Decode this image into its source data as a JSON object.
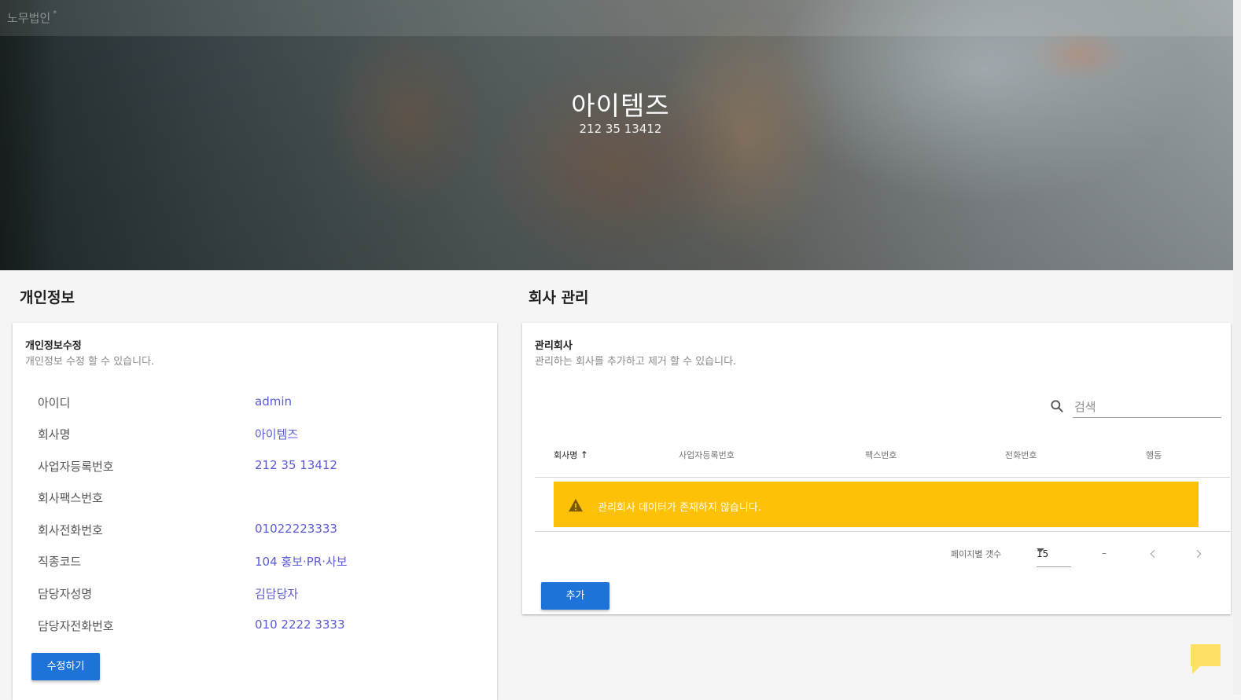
{
  "app": {
    "brand": "노무법인",
    "brand_mark": "*"
  },
  "hero": {
    "title": "아이템즈",
    "subtitle": "212 35 13412"
  },
  "personal": {
    "section_title": "개인정보",
    "card_title": "개인정보수정",
    "card_desc": "개인정보 수정 할 수 있습니다.",
    "rows": [
      {
        "label": "아이디",
        "value": "admin"
      },
      {
        "label": "회사명",
        "value": "아이템즈"
      },
      {
        "label": "사업자등록번호",
        "value": "212 35 13412"
      },
      {
        "label": "회사팩스번호",
        "value": ""
      },
      {
        "label": "회사전화번호",
        "value": "01022223333"
      },
      {
        "label": "직종코드",
        "value": "104 홍보·PR·사보"
      },
      {
        "label": "담당자성명",
        "value": "김담당자"
      },
      {
        "label": "담당자전화번호",
        "value": "010 2222 3333"
      }
    ],
    "edit_button": "수정하기"
  },
  "company": {
    "section_title": "회사 관리",
    "card_title": "관리회사",
    "card_desc": "관리하는 회사를 추가하고 제거 할 수 있습니다.",
    "search_placeholder": "검색",
    "columns": [
      "회사명",
      "사업자등록번호",
      "팩스번호",
      "전화번호",
      "행동"
    ],
    "sort_indicator": "↑",
    "empty_message": "관리회사 데이터가 존재하지 않습니다.",
    "rows_per_page_label": "페이지별 갯수",
    "rows_per_page": "15",
    "page_range": "–",
    "add_button": "추가"
  },
  "colors": {
    "accent": "#1e73d8",
    "link": "#5b5bd6",
    "warning": "#ffc107",
    "chat": "#ffe066"
  },
  "icons": [
    "search-icon",
    "warning-icon",
    "chevron-left-icon",
    "chevron-right-icon",
    "chat-icon",
    "sort-up-icon"
  ]
}
